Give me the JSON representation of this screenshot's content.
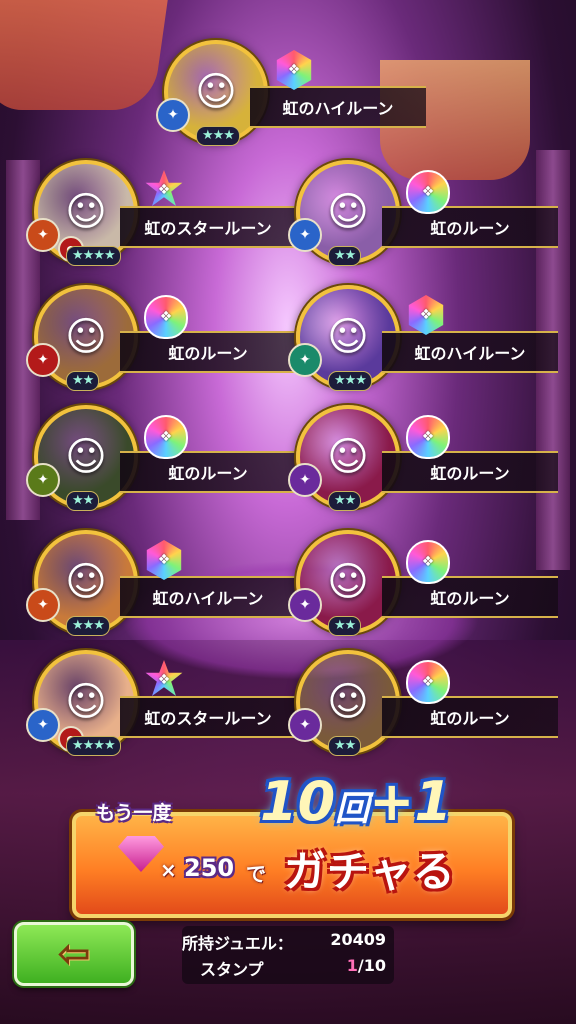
{
  "results": [
    {
      "character": "crowned-boy",
      "stars": "★★★",
      "rune_type": "hex",
      "item": "虹のハイルーン",
      "portrait_bg": "#d6b23a",
      "badge_color": "#2a64c9",
      "badge2_color": null
    },
    {
      "character": "veiled-lady",
      "stars": "★★★★",
      "rune_type": "star",
      "item": "虹のスタールーン",
      "portrait_bg": "#c9b9a8",
      "badge_color": "#c94a1a",
      "badge2_color": "#b31a1a"
    },
    {
      "character": "dark-elf",
      "stars": "★★",
      "rune_type": "drop",
      "item": "虹のルーン",
      "portrait_bg": "#8a5ea8",
      "badge_color": "#2a64c9",
      "badge2_color": null
    },
    {
      "character": "brown-cat",
      "stars": "★★",
      "rune_type": "drop",
      "item": "虹のルーン",
      "portrait_bg": "#9c6b3a",
      "badge_color": "#b31a1a",
      "badge2_color": null
    },
    {
      "character": "armored-knight",
      "stars": "★★★",
      "rune_type": "hex",
      "item": "虹のハイルーン",
      "portrait_bg": "#5a3a9c",
      "badge_color": "#1a8a6a",
      "badge2_color": null
    },
    {
      "character": "black-cat",
      "stars": "★★",
      "rune_type": "drop",
      "item": "虹のルーン",
      "portrait_bg": "#3a4a2a",
      "badge_color": "#5a7a1a",
      "badge2_color": null
    },
    {
      "character": "crimson-armor",
      "stars": "★★",
      "rune_type": "drop",
      "item": "虹のルーン",
      "portrait_bg": "#8a1a4a",
      "badge_color": "#6a2a9c",
      "badge2_color": null
    },
    {
      "character": "fox-girl",
      "stars": "★★★",
      "rune_type": "hex",
      "item": "虹のハイルーン",
      "portrait_bg": "#c97a3a",
      "badge_color": "#c94a1a",
      "badge2_color": null
    },
    {
      "character": "crimson-armor",
      "stars": "★★",
      "rune_type": "drop",
      "item": "虹のルーン",
      "portrait_bg": "#8a1a4a",
      "badge_color": "#6a2a9c",
      "badge2_color": null
    },
    {
      "character": "flower-fox-girl",
      "stars": "★★★★",
      "rune_type": "star",
      "item": "虹のスタールーン",
      "portrait_bg": "#e8b08a",
      "badge_color": "#2a64c9",
      "badge2_color": "#b31a1a"
    },
    {
      "character": "white-cat",
      "stars": "★★",
      "rune_type": "drop",
      "item": "虹のルーン",
      "portrait_bg": "#7a5a3a",
      "badge_color": "#6a2a9c",
      "badge2_color": null
    }
  ],
  "gacha_button": {
    "again": "もう一度",
    "times": "×",
    "cost": "250",
    "de": "で",
    "action": "ガチャる",
    "count": "10",
    "count_unit": "回",
    "bonus": "+1"
  },
  "back_button": {
    "icon": "left-arrow-icon"
  },
  "status": {
    "jewel_label": "所持ジュエル：",
    "jewel_value": "20409",
    "stamp_label": "スタンプ",
    "stamp_current": "1",
    "stamp_total": "/10"
  },
  "colors": {
    "accent_gold": "#f2c23d",
    "banner_orange": "#ff7f24",
    "back_green": "#5cc837",
    "stamp_pink": "#ff6fb8"
  }
}
